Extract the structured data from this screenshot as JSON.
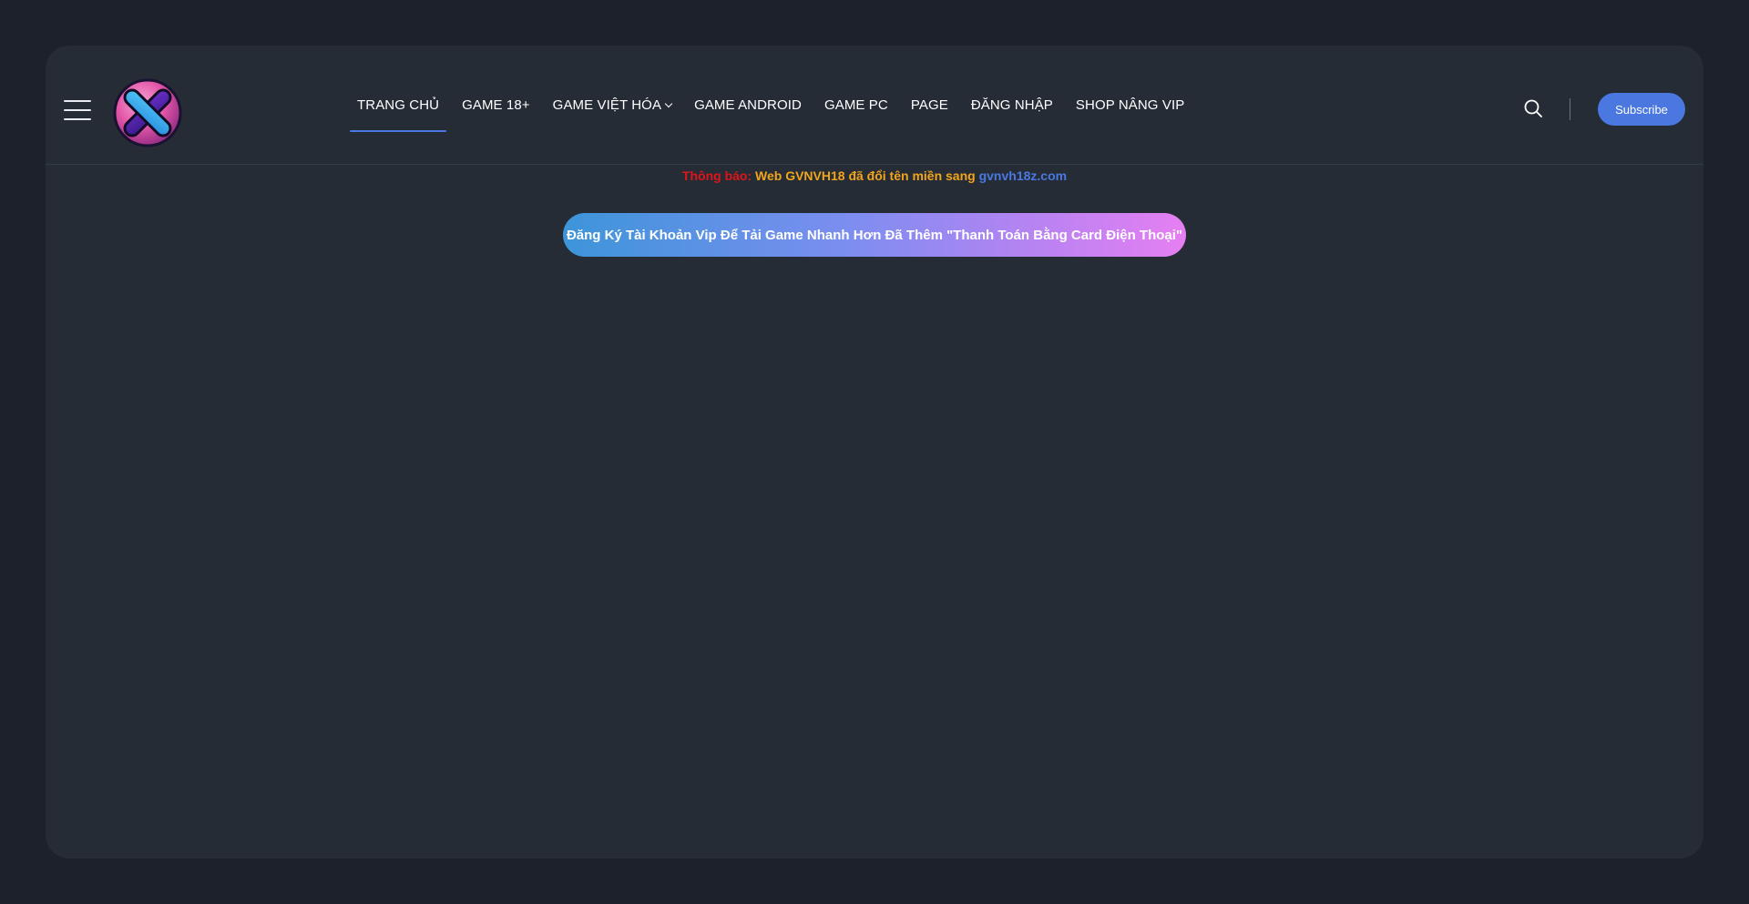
{
  "header": {
    "menu_icon": "hamburger-menu-icon",
    "logo_icon": "x-orb-logo-icon",
    "nav": [
      {
        "label": "TRANG CHỦ",
        "active": true
      },
      {
        "label": "GAME 18+"
      },
      {
        "label": "GAME VIỆT HÓA",
        "has_dropdown": true
      },
      {
        "label": "GAME ANDROID"
      },
      {
        "label": "GAME PC"
      },
      {
        "label": "PAGE"
      },
      {
        "label": "ĐĂNG NHẬP"
      },
      {
        "label": "SHOP NÂNG VIP"
      }
    ],
    "search_icon": "search-icon",
    "subscribe_label": "Subscribe"
  },
  "notice": {
    "label": "Thông báo:",
    "message": " Web GVNVH18 đã đổi tên miền sang ",
    "domain": "gvnvh18z.com"
  },
  "vip_banner": {
    "label": "Đăng Ký Tài Khoản Vip Để Tải Game Nhanh Hơn Đã Thêm \"Thanh Toán Bằng Card Điện Thoại\""
  },
  "colors": {
    "page_bg": "#1d212b",
    "panel_bg": "#252c36",
    "accent": "#4a77e0",
    "notice_label": "#e0141b",
    "notice_message": "#f2a51a"
  }
}
